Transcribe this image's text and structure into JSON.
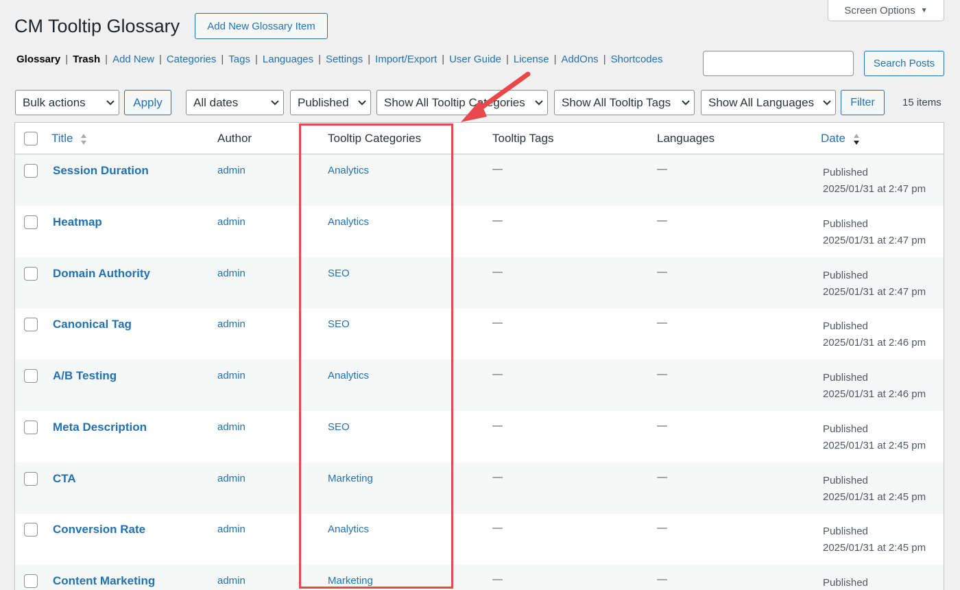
{
  "screen_options": {
    "label": "Screen Options",
    "icon": "triangle-down-icon"
  },
  "page": {
    "title": "CM Tooltip Glossary",
    "add_new_label": "Add New Glossary Item"
  },
  "views": [
    {
      "label": "Glossary",
      "current": true
    },
    {
      "label": "Trash",
      "current": true
    },
    {
      "label": "Add New"
    },
    {
      "label": "Categories"
    },
    {
      "label": "Tags"
    },
    {
      "label": "Languages"
    },
    {
      "label": "Settings"
    },
    {
      "label": "Import/Export"
    },
    {
      "label": "User Guide"
    },
    {
      "label": "License"
    },
    {
      "label": "AddOns"
    },
    {
      "label": "Shortcodes"
    }
  ],
  "search": {
    "value": "",
    "button_label": "Search Posts"
  },
  "filters": {
    "bulk_actions": "Bulk actions",
    "apply_label": "Apply",
    "dates": "All dates",
    "status": "Published",
    "categories": "Show All Tooltip Categories",
    "tags": "Show All Tooltip Tags",
    "languages": "Show All Languages",
    "filter_label": "Filter",
    "items_count": "15 items"
  },
  "table": {
    "columns": {
      "title": "Title",
      "author": "Author",
      "categories": "Tooltip Categories",
      "tags": "Tooltip Tags",
      "languages": "Languages",
      "date": "Date"
    },
    "rows": [
      {
        "title": "Session Duration",
        "author": "admin",
        "category": "Analytics",
        "tags": "—",
        "languages": "—",
        "status": "Published",
        "date": "2025/01/31 at 2:47 pm"
      },
      {
        "title": "Heatmap",
        "author": "admin",
        "category": "Analytics",
        "tags": "—",
        "languages": "—",
        "status": "Published",
        "date": "2025/01/31 at 2:47 pm"
      },
      {
        "title": "Domain Authority",
        "author": "admin",
        "category": "SEO",
        "tags": "—",
        "languages": "—",
        "status": "Published",
        "date": "2025/01/31 at 2:47 pm"
      },
      {
        "title": "Canonical Tag",
        "author": "admin",
        "category": "SEO",
        "tags": "—",
        "languages": "—",
        "status": "Published",
        "date": "2025/01/31 at 2:46 pm"
      },
      {
        "title": "A/B Testing",
        "author": "admin",
        "category": "Analytics",
        "tags": "—",
        "languages": "—",
        "status": "Published",
        "date": "2025/01/31 at 2:46 pm"
      },
      {
        "title": "Meta Description",
        "author": "admin",
        "category": "SEO",
        "tags": "—",
        "languages": "—",
        "status": "Published",
        "date": "2025/01/31 at 2:45 pm"
      },
      {
        "title": "CTA",
        "author": "admin",
        "category": "Marketing",
        "tags": "—",
        "languages": "—",
        "status": "Published",
        "date": "2025/01/31 at 2:45 pm"
      },
      {
        "title": "Conversion Rate",
        "author": "admin",
        "category": "Analytics",
        "tags": "—",
        "languages": "—",
        "status": "Published",
        "date": "2025/01/31 at 2:45 pm"
      },
      {
        "title": "Content Marketing",
        "author": "admin",
        "category": "Marketing",
        "tags": "—",
        "languages": "—",
        "status": "Published",
        "date": ""
      }
    ]
  },
  "annotation": {
    "color": "#e8474b"
  }
}
